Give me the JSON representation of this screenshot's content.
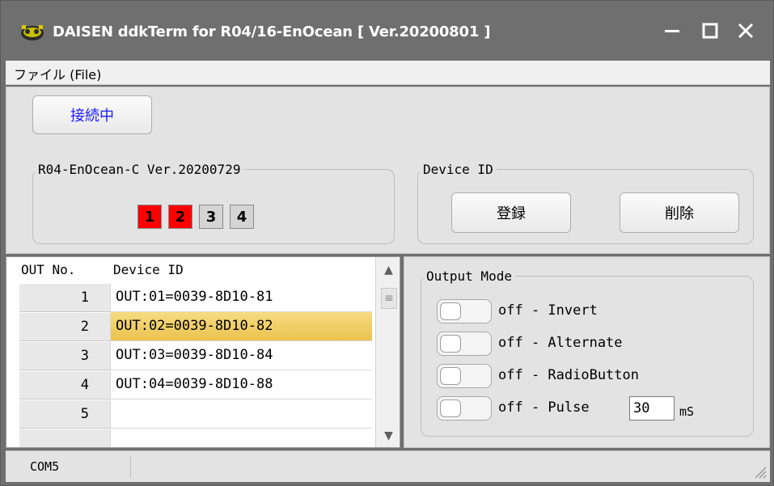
{
  "window": {
    "title": "DAISEN ddkTerm for R04/16-EnOcean [ Ver.20200801 ]",
    "controls": {
      "minimize": "minimize",
      "maximize": "maximize",
      "close": "close"
    }
  },
  "menu": {
    "file_label": "ファイル (File)"
  },
  "connection": {
    "button_label": "接続中"
  },
  "firmware": {
    "legend": "R04-EnOcean-C Ver.20200729",
    "outputs": [
      {
        "label": "1",
        "state": "on"
      },
      {
        "label": "2",
        "state": "on"
      },
      {
        "label": "3",
        "state": "off"
      },
      {
        "label": "4",
        "state": "off"
      }
    ]
  },
  "device_id": {
    "legend": "Device ID",
    "register_label": "登録",
    "delete_label": "削除"
  },
  "table": {
    "columns": [
      "OUT No.",
      "Device ID"
    ],
    "rows": [
      {
        "no": "1",
        "device": "OUT:01=0039-8D10-81",
        "selected": false
      },
      {
        "no": "2",
        "device": "OUT:02=0039-8D10-82",
        "selected": true
      },
      {
        "no": "3",
        "device": "OUT:03=0039-8D10-84",
        "selected": false
      },
      {
        "no": "4",
        "device": "OUT:04=0039-8D10-88",
        "selected": false
      },
      {
        "no": "5",
        "device": "",
        "selected": false
      }
    ]
  },
  "output_mode": {
    "legend": "Output Mode",
    "modes": [
      {
        "label": "off - Invert",
        "state": "off"
      },
      {
        "label": "off - Alternate",
        "state": "off"
      },
      {
        "label": "off - RadioButton",
        "state": "off"
      },
      {
        "label": "off - Pulse",
        "state": "off"
      }
    ],
    "pulse_value": "30",
    "pulse_unit": "mS"
  },
  "status": {
    "port": "COM5"
  },
  "colors": {
    "titlebar": "#6f6f6f",
    "led_on": "#ff0000",
    "led_off": "#d4d4d4",
    "selection": "#f0cf66",
    "connected_text": "#1a1aff"
  }
}
